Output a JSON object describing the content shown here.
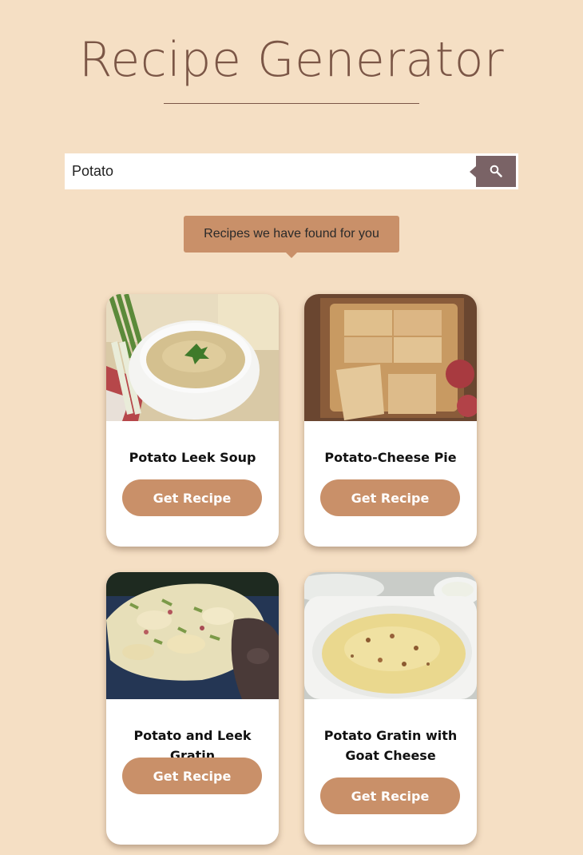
{
  "header": {
    "title": "Recipe Generator"
  },
  "search": {
    "value": "Potato",
    "button_icon": "search-icon"
  },
  "results_label": "Recipes we have found for you",
  "colors": {
    "background": "#f5dfc4",
    "title": "#7b5646",
    "accent": "#c99069",
    "search_button": "#7a6366"
  },
  "recipes": [
    {
      "title": "Potato Leek Soup",
      "button_label": "Get Recipe",
      "image": "potato-leek-soup-photo"
    },
    {
      "title": "Potato-Cheese Pie",
      "button_label": "Get Recipe",
      "image": "potato-cheese-pie-photo"
    },
    {
      "title": "Potato and Leek Gratin",
      "button_label": "Get Recipe",
      "image": "potato-leek-gratin-photo"
    },
    {
      "title": "Potato Gratin with Goat Cheese",
      "button_label": "Get Recipe",
      "image": "potato-gratin-goat-cheese-photo"
    }
  ]
}
